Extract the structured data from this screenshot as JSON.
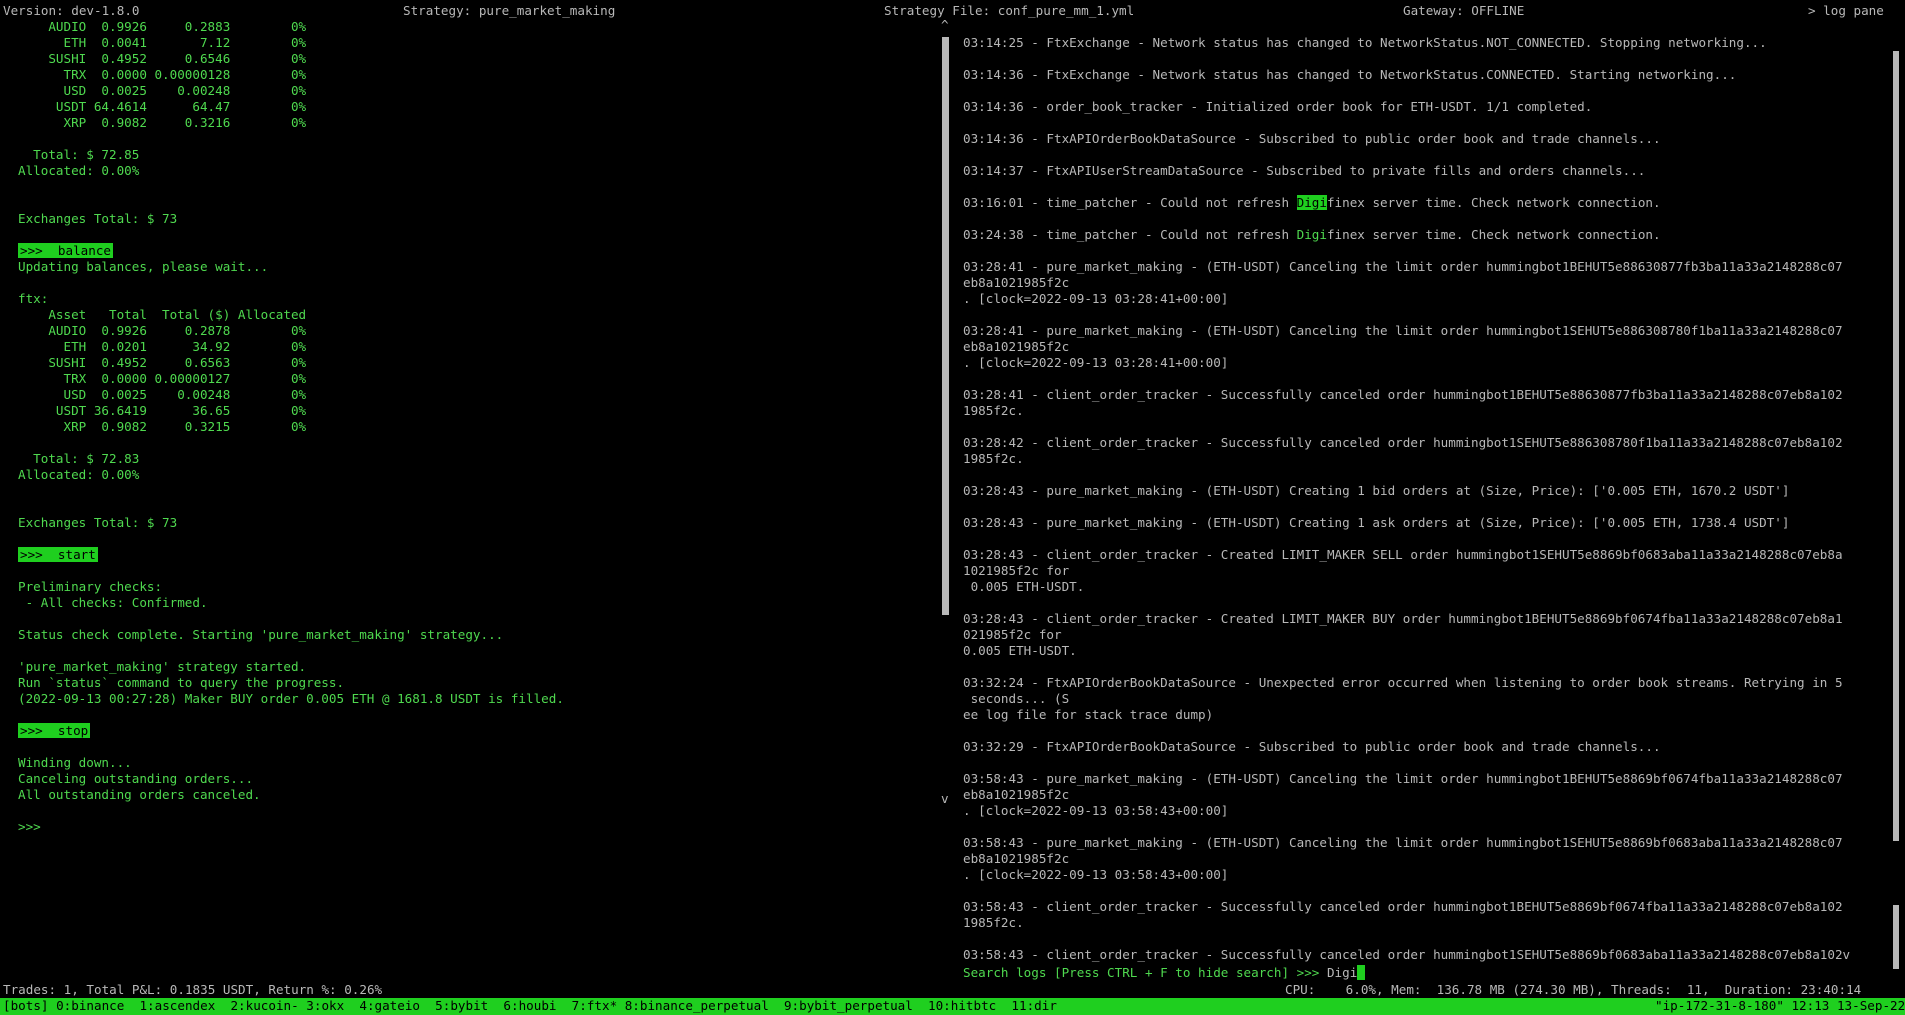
{
  "topbar": {
    "version": "Version: dev-1.8.0",
    "strategy": "Strategy: pure_market_making",
    "strategy_file": "Strategy File: conf_pure_mm_1.yml",
    "gateway": "Gateway: OFFLINE",
    "log_pane": "> log pane"
  },
  "output": {
    "lines": [
      {
        "t": "    AUDIO  0.9926     0.2883        0%"
      },
      {
        "t": "      ETH  0.0041       7.12        0%"
      },
      {
        "t": "    SUSHI  0.4952     0.6546        0%"
      },
      {
        "t": "      TRX  0.0000 0.00000128        0%"
      },
      {
        "t": "      USD  0.0025    0.00248        0%"
      },
      {
        "t": "     USDT 64.4614      64.47        0%"
      },
      {
        "t": "      XRP  0.9082     0.3216        0%"
      },
      {
        "t": ""
      },
      {
        "t": "  Total: $ 72.85"
      },
      {
        "t": "Allocated: 0.00%"
      },
      {
        "t": ""
      },
      {
        "t": ""
      },
      {
        "t": "Exchanges Total: $ 73"
      },
      {
        "t": ""
      },
      {
        "t": ">>>  balance",
        "cmd": true
      },
      {
        "t": "Updating balances, please wait..."
      },
      {
        "t": ""
      },
      {
        "t": "ftx:"
      },
      {
        "t": "    Asset   Total  Total ($) Allocated"
      },
      {
        "t": "    AUDIO  0.9926     0.2878        0%"
      },
      {
        "t": "      ETH  0.0201      34.92        0%"
      },
      {
        "t": "    SUSHI  0.4952     0.6563        0%"
      },
      {
        "t": "      TRX  0.0000 0.00000127        0%"
      },
      {
        "t": "      USD  0.0025    0.00248        0%"
      },
      {
        "t": "     USDT 36.6419      36.65        0%"
      },
      {
        "t": "      XRP  0.9082     0.3215        0%"
      },
      {
        "t": ""
      },
      {
        "t": "  Total: $ 72.83"
      },
      {
        "t": "Allocated: 0.00%"
      },
      {
        "t": ""
      },
      {
        "t": ""
      },
      {
        "t": "Exchanges Total: $ 73"
      },
      {
        "t": ""
      },
      {
        "t": ">>>  start",
        "cmd": true
      },
      {
        "t": ""
      },
      {
        "t": "Preliminary checks:"
      },
      {
        "t": " - All checks: Confirmed."
      },
      {
        "t": ""
      },
      {
        "t": "Status check complete. Starting 'pure_market_making' strategy..."
      },
      {
        "t": ""
      },
      {
        "t": "'pure_market_making' strategy started."
      },
      {
        "t": "Run `status` command to query the progress."
      },
      {
        "t": "(2022-09-13 00:27:28) Maker BUY order 0.005 ETH @ 1681.8 USDT is filled."
      },
      {
        "t": ""
      },
      {
        "t": ">>>  stop",
        "cmd": true
      },
      {
        "t": ""
      },
      {
        "t": "Winding down..."
      },
      {
        "t": "Canceling outstanding orders..."
      },
      {
        "t": "All outstanding orders canceled."
      },
      {
        "t": ""
      },
      {
        "t": ">>>"
      }
    ]
  },
  "divider": {
    "up_arrow": "^",
    "down_arrow": "v"
  },
  "log": {
    "entries": [
      {
        "lines": [
          "03:14:25 - FtxExchange - Network status has changed to NetworkStatus.NOT_CONNECTED. Stopping networking..."
        ]
      },
      {
        "lines": [
          "03:14:36 - FtxExchange - Network status has changed to NetworkStatus.CONNECTED. Starting networking..."
        ]
      },
      {
        "lines": [
          "03:14:36 - order_book_tracker - Initialized order book for ETH-USDT. 1/1 completed."
        ]
      },
      {
        "lines": [
          "03:14:36 - FtxAPIOrderBookDataSource - Subscribed to public order book and trade channels..."
        ]
      },
      {
        "lines": [
          "03:14:37 - FtxAPIUserStreamDataSource - Subscribed to private fills and orders channels..."
        ]
      },
      {
        "segments": [
          "03:16:01 - time_patcher - Could not refresh ",
          "Digi",
          "finex server time. Check network connection."
        ],
        "hl": "box"
      },
      {
        "segments": [
          "03:24:38 - time_patcher - Could not refresh ",
          "Digi",
          "finex server time. Check network connection."
        ],
        "hl": "text"
      },
      {
        "lines": [
          "03:28:41 - pure_market_making - (ETH-USDT) Canceling the limit order hummingbot1BEHUT5e88630877fb3ba11a33a2148288c07",
          "eb8a1021985f2c",
          ". [clock=2022-09-13 03:28:41+00:00]"
        ]
      },
      {
        "lines": [
          "03:28:41 - pure_market_making - (ETH-USDT) Canceling the limit order hummingbot1SEHUT5e886308780f1ba11a33a2148288c07",
          "eb8a1021985f2c",
          ". [clock=2022-09-13 03:28:41+00:00]"
        ]
      },
      {
        "lines": [
          "03:28:41 - client_order_tracker - Successfully canceled order hummingbot1BEHUT5e88630877fb3ba11a33a2148288c07eb8a102",
          "1985f2c."
        ]
      },
      {
        "lines": [
          "03:28:42 - client_order_tracker - Successfully canceled order hummingbot1SEHUT5e886308780f1ba11a33a2148288c07eb8a102",
          "1985f2c."
        ]
      },
      {
        "lines": [
          "03:28:43 - pure_market_making - (ETH-USDT) Creating 1 bid orders at (Size, Price): ['0.005 ETH, 1670.2 USDT']"
        ]
      },
      {
        "lines": [
          "03:28:43 - pure_market_making - (ETH-USDT) Creating 1 ask orders at (Size, Price): ['0.005 ETH, 1738.4 USDT']"
        ]
      },
      {
        "lines": [
          "03:28:43 - client_order_tracker - Created LIMIT_MAKER SELL order hummingbot1SEHUT5e8869bf0683aba11a33a2148288c07eb8a",
          "1021985f2c for",
          " 0.005 ETH-USDT."
        ]
      },
      {
        "lines": [
          "03:28:43 - client_order_tracker - Created LIMIT_MAKER BUY order hummingbot1BEHUT5e8869bf0674fba11a33a2148288c07eb8a1",
          "021985f2c for",
          "0.005 ETH-USDT."
        ]
      },
      {
        "lines": [
          "03:32:24 - FtxAPIOrderBookDataSource - Unexpected error occurred when listening to order book streams. Retrying in 5",
          " seconds... (S",
          "ee log file for stack trace dump)"
        ]
      },
      {
        "lines": [
          "03:32:29 - FtxAPIOrderBookDataSource - Subscribed to public order book and trade channels..."
        ]
      },
      {
        "lines": [
          "03:58:43 - pure_market_making - (ETH-USDT) Canceling the limit order hummingbot1BEHUT5e8869bf0674fba11a33a2148288c07",
          "eb8a1021985f2c",
          ". [clock=2022-09-13 03:58:43+00:00]"
        ]
      },
      {
        "lines": [
          "03:58:43 - pure_market_making - (ETH-USDT) Canceling the limit order hummingbot1SEHUT5e8869bf0683aba11a33a2148288c07",
          "eb8a1021985f2c",
          ". [clock=2022-09-13 03:58:43+00:00]"
        ]
      },
      {
        "lines": [
          "03:58:43 - client_order_tracker - Successfully canceled order hummingbot1BEHUT5e8869bf0674fba11a33a2148288c07eb8a102",
          "1985f2c."
        ]
      },
      {
        "lines": [
          "03:58:43 - client_order_tracker - Successfully canceled order hummingbot1SEHUT5e8869bf0683aba11a33a2148288c07eb8a102v"
        ]
      }
    ]
  },
  "search": {
    "label": "Search logs [Press CTRL + F to hide search] >>> ",
    "value": "Digi"
  },
  "status": {
    "trades": "Trades: 1, Total P&L: 0.1835 USDT, Return %: 0.26%",
    "sysinfo": "CPU:    6.0%, Mem:  136.78 MB (274.30 MB), Threads:  11,  Duration: 23:40:14"
  },
  "tmux": {
    "windows": "[bots] 0:binance  1:ascendex  2:kucoin- 3:okx  4:gateio  5:bybit  6:houbi  7:ftx* 8:binance_perpetual  9:bybit_perpetual  10:hitbtc  11:dir",
    "host": "\"ip-172-31-8-180\" 12:13 13-Sep-22"
  }
}
